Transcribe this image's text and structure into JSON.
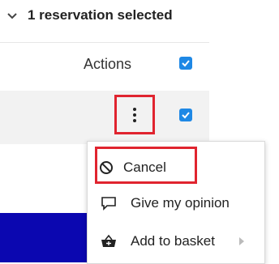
{
  "header": {
    "title": "1 reservation selected",
    "icon": "chevron-down-icon"
  },
  "table": {
    "actions_label": "Actions"
  },
  "menu": {
    "items": [
      {
        "label": "Cancel",
        "icon": "cancel-icon"
      },
      {
        "label": "Give my opinion",
        "icon": "comment-icon"
      },
      {
        "label": "Add to basket",
        "icon": "basket-icon",
        "submenu_icon": "chevron-right-icon"
      }
    ]
  },
  "colors": {
    "checkbox": "#1e88e5",
    "highlight": "#e0242f",
    "blue_bar": "#0b07b0",
    "row_bg": "#f2f2f2"
  }
}
